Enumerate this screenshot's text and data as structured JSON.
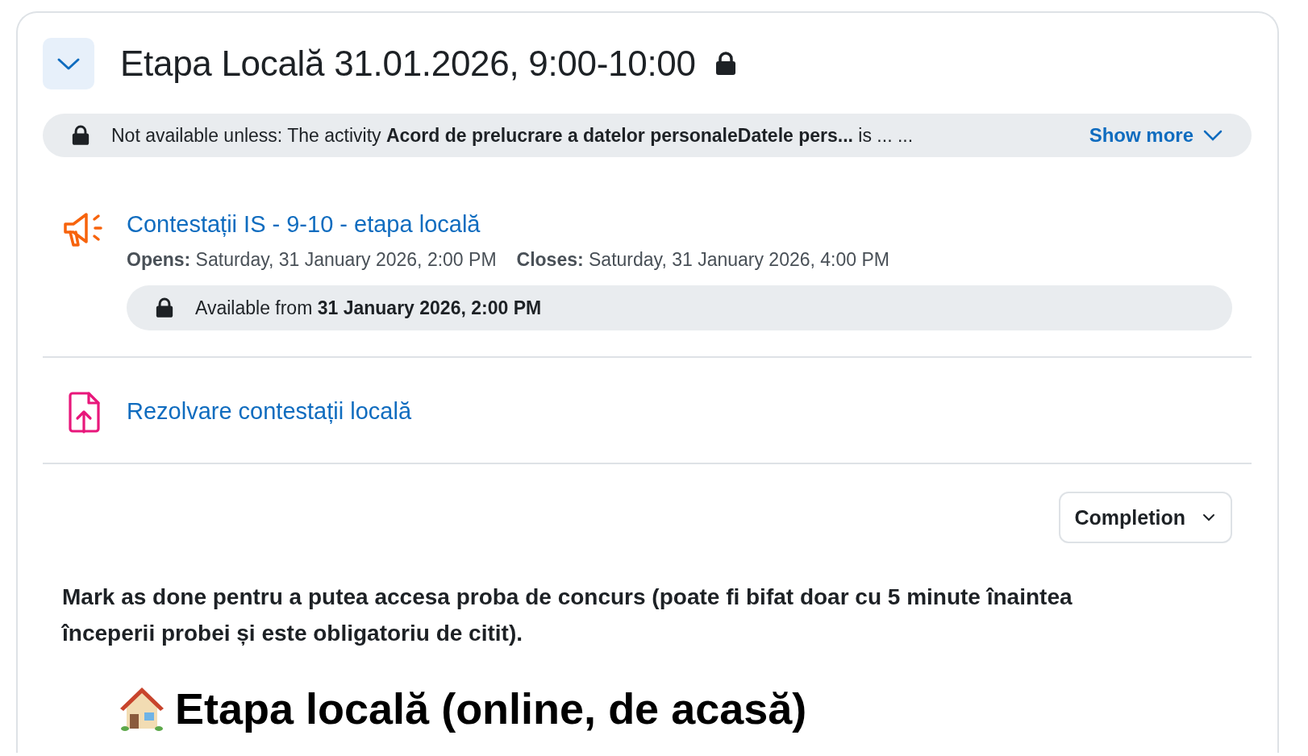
{
  "section": {
    "title": "Etapa Locală 31.01.2026, 9:00-10:00",
    "expanded": true
  },
  "restriction": {
    "text": "Not available unless: The activity **Acord de prelucrare a datelor personaleDatele pers...** is ... ...",
    "show_more": "Show more"
  },
  "activities": [
    {
      "kind": "announcement",
      "title": "Contestații IS - 9-10 - etapa locală",
      "dates": [
        {
          "label": "Opens:",
          "value": "Saturday, 31 January 2026, 2:00 PM"
        },
        {
          "label": "Closes:",
          "value": "Saturday, 31 January 2026, 4:00 PM"
        }
      ],
      "availability": "Available from **31 January 2026, 2:00 PM**"
    },
    {
      "kind": "upload",
      "title": "Rezolvare contestații locală"
    }
  ],
  "completion_button": "Completion",
  "description": "Mark as done pentru a putea accesa proba de concurs (poate fi bifat doar cu 5 minute înaintea începerii probei și este obligatoriu de citit).",
  "heading": "Etapa locală (online, de acasă)"
}
